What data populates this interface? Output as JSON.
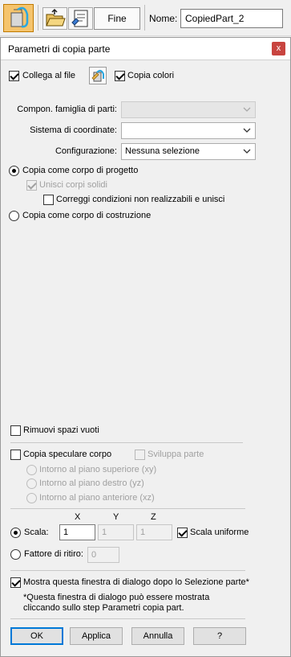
{
  "toolbar": {
    "fine_label": "Fine",
    "nome_label": "Nome:",
    "nome_value": "CopiedPart_2"
  },
  "dialog": {
    "title": "Parametri di copia parte",
    "close_glyph": "x",
    "collega_al_file": "Collega al file",
    "copia_colori": "Copia colori",
    "famiglia_label": "Compon. famiglia di parti:",
    "famiglia_value": "",
    "sistema_label": "Sistema di coordinate:",
    "sistema_value": "",
    "configurazione_label": "Configurazione:",
    "configurazione_value": "Nessuna selezione",
    "copia_corpo_progetto": "Copia come corpo di progetto",
    "unisci_corpi": "Unisci corpi solidi",
    "correggi_condizioni": "Correggi condizioni non realizzabili e unisci",
    "copia_corpo_costruzione": "Copia come corpo di costruzione",
    "rimuovi_spazi": "Rimuovi spazi vuoti",
    "copia_speculare": "Copia speculare corpo",
    "sviluppa_parte": "Sviluppa parte",
    "piano_superiore": "Intorno al piano superiore (xy)",
    "piano_destro": "Intorno al piano destro (yz)",
    "piano_anteriore": "Intorno al piano anteriore (xz)",
    "col_x": "X",
    "col_y": "Y",
    "col_z": "Z",
    "scala_label": "Scala:",
    "scala_x": "1",
    "scala_y": "1",
    "scala_z": "1",
    "scala_uniforme": "Scala uniforme",
    "fattore_label": "Fattore di ritiro:",
    "fattore_value": "0",
    "mostra_finestra": "Mostra questa finestra di dialogo dopo lo Selezione parte*",
    "nota_line1": "*Questa finestra di dialogo può essere mostrata",
    "nota_line2": "cliccando sullo step Parametri copia part.",
    "ok_label": "OK",
    "applica_label": "Applica",
    "annulla_label": "Annulla",
    "help_label": "?"
  },
  "colors": {
    "active_step": "#f5c46d",
    "close_button": "#c8443f",
    "default_button_border": "#0078d7"
  }
}
